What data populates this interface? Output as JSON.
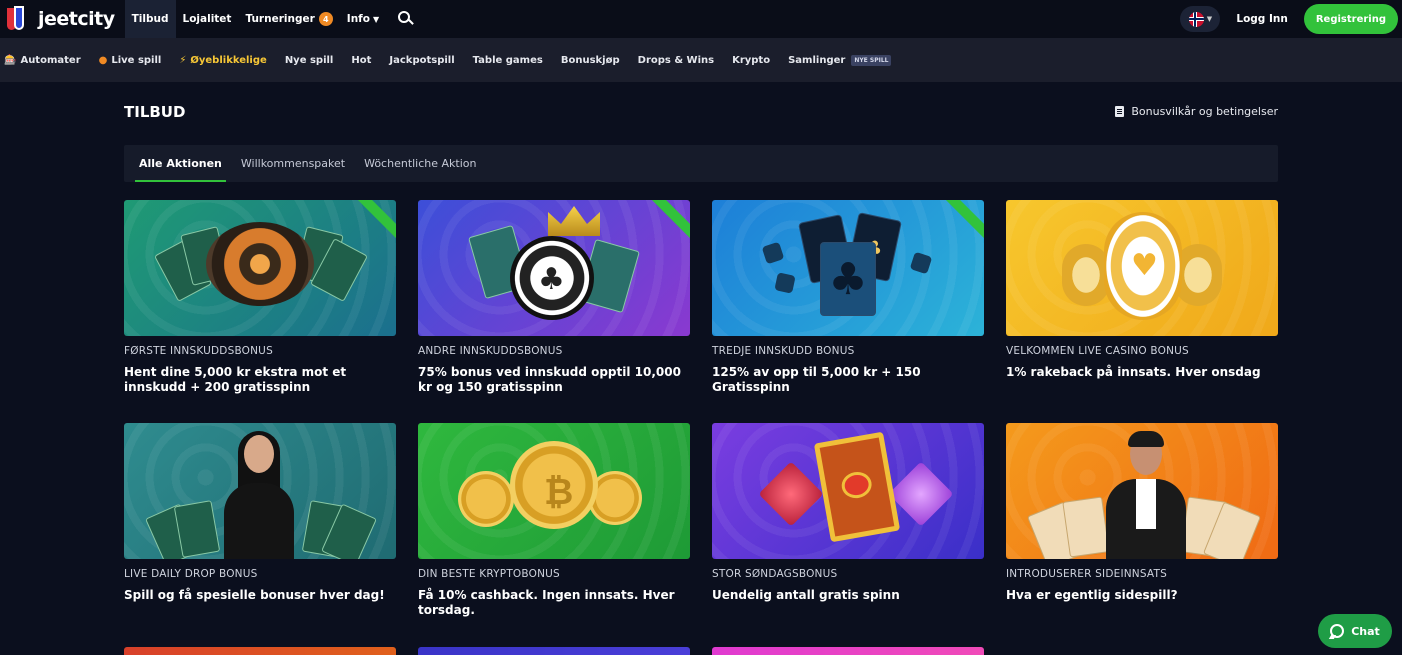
{
  "brand": {
    "name": "jeetcity"
  },
  "topnav": {
    "items": [
      {
        "label": "Tilbud"
      },
      {
        "label": "Lojalitet"
      },
      {
        "label": "Turneringer",
        "badge": "4"
      },
      {
        "label": "Info"
      }
    ],
    "login_label": "Logg Inn",
    "register_label": "Registrering",
    "language_icon": "norway-flag-icon"
  },
  "categories": [
    {
      "label": "Automater",
      "icon": "🎰"
    },
    {
      "label": "Live spill",
      "icon": "●"
    },
    {
      "label": "Øyeblikkelige",
      "icon": "⚡"
    },
    {
      "label": "Nye spill"
    },
    {
      "label": "Hot"
    },
    {
      "label": "Jackpotspill"
    },
    {
      "label": "Table games"
    },
    {
      "label": "Bonuskjøp"
    },
    {
      "label": "Drops & Wins"
    },
    {
      "label": "Krypto"
    },
    {
      "label": "Samlinger"
    }
  ],
  "new_tag": "NYE SPILL",
  "page": {
    "title": "TILBUD",
    "terms_label": "Bonusvilkår og betingelser"
  },
  "tabs": [
    {
      "label": "Alle Aktionen"
    },
    {
      "label": "Willkommenspaket"
    },
    {
      "label": "Wöchentliche Aktion"
    }
  ],
  "promos": [
    {
      "label": "FØRSTE INNSKUDDSBONUS",
      "title": "Hent dine 5,000 kr ekstra mot et innskudd + 200 gratisspinn"
    },
    {
      "label": "ANDRE INNSKUDDSBONUS",
      "title": "75% bonus ved innskudd opptil 10,000 kr og 150 gratisspinn"
    },
    {
      "label": "TREDJE INNSKUDD BONUS",
      "title": "125% av opp til 5,000 kr + 150 Gratisspinn"
    },
    {
      "label": "VELKOMMEN LIVE CASINO BONUS",
      "title": "1% rakeback på innsats. Hver onsdag"
    },
    {
      "label": "LIVE DAILY DROP BONUS",
      "title": "Spill og få spesielle bonuser hver dag!"
    },
    {
      "label": "DIN BESTE KRYPTOBONUS",
      "title": "Få 10% cashback. Ingen innsats. Hver torsdag."
    },
    {
      "label": "STOR SØNDAGSBONUS",
      "title": "Uendelig antall gratis spinn"
    },
    {
      "label": "INTRODUSERER SIDEINNSATS",
      "title": "Hva er egentlig sidespill?"
    }
  ],
  "chat_label": "Chat",
  "colors": {
    "accent_green": "#32c23b",
    "background": "#0b0f1e",
    "badge_orange": "#f08a24"
  }
}
